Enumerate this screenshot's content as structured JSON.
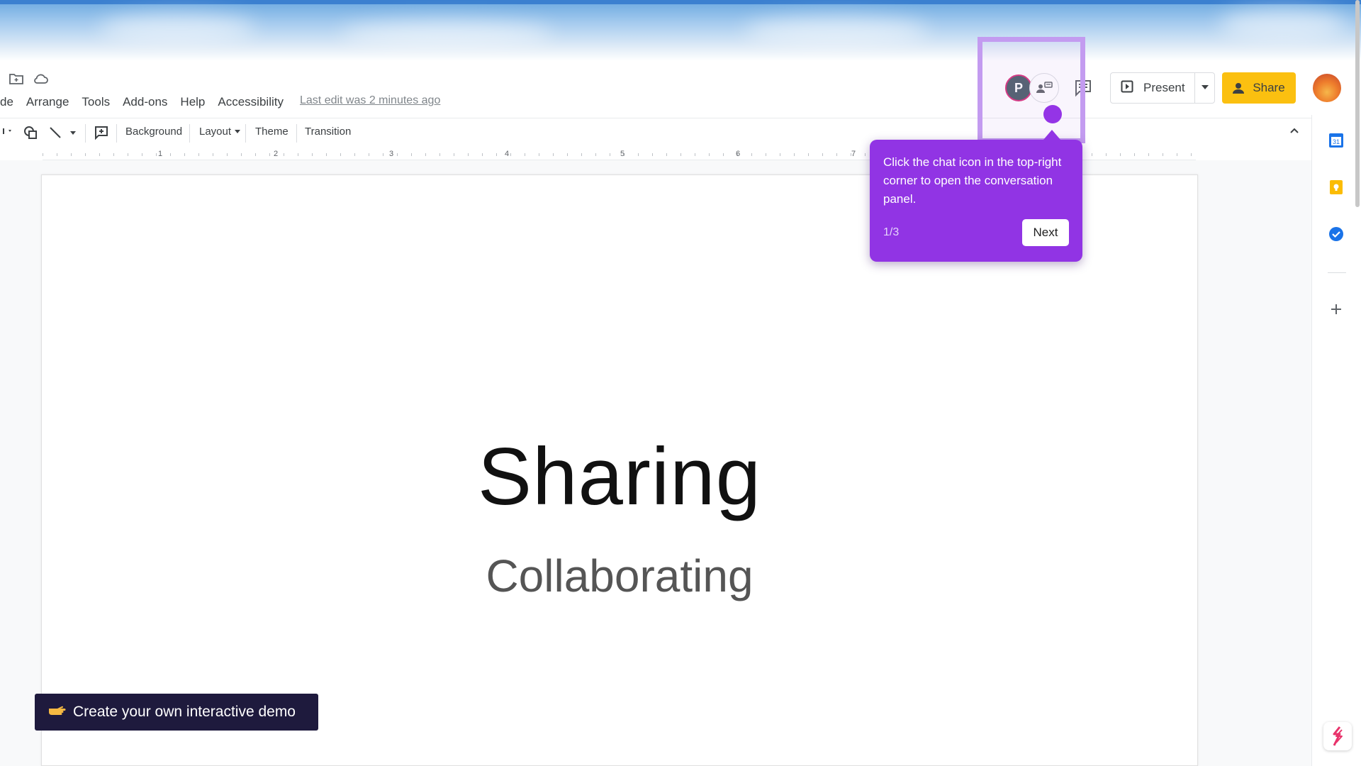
{
  "menubar": {
    "items": [
      "de",
      "Arrange",
      "Tools",
      "Add-ons",
      "Help",
      "Accessibility"
    ],
    "last_edit": "Last edit was 2 minutes ago"
  },
  "header": {
    "collaborator_initial": "P",
    "present_label": "Present",
    "share_label": "Share"
  },
  "toolbar": {
    "background_label": "Background",
    "layout_label": "Layout",
    "theme_label": "Theme",
    "transition_label": "Transition"
  },
  "ruler": {
    "numbers": [
      "1",
      "2",
      "3",
      "4",
      "5",
      "6",
      "7"
    ]
  },
  "slide": {
    "title": "Sharing",
    "subtitle": "Collaborating"
  },
  "guide": {
    "text": "Click the chat icon in the top-right corner to open the conversation panel.",
    "step": "1/3",
    "next_label": "Next"
  },
  "demo_badge": {
    "label": "Create your own interactive demo"
  },
  "colors": {
    "accent_purple": "#9134e4",
    "highlight": "#c39bf0",
    "share_yellow": "#fbc010",
    "badge_navy": "#1e1a3d"
  }
}
